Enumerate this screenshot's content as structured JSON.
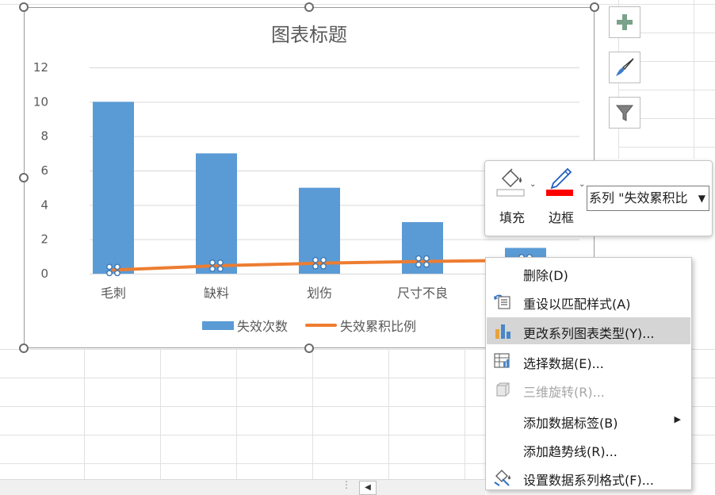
{
  "chart": {
    "title": "图表标题"
  },
  "chart_data": {
    "type": "bar",
    "categories": [
      "毛刺",
      "缺料",
      "划伤",
      "尺寸不良",
      ""
    ],
    "series": [
      {
        "name": "失效次数",
        "type": "bar",
        "values": [
          10,
          7,
          5,
          3,
          1.5
        ]
      },
      {
        "name": "失效累积比例",
        "type": "line",
        "values": [
          0.38,
          0.65,
          0.81,
          0.92,
          1.0
        ]
      }
    ],
    "yticks": [
      "0",
      "2",
      "4",
      "6",
      "8",
      "10",
      "12"
    ],
    "ylim": [
      0,
      12
    ],
    "grid": true,
    "legend": "bottom",
    "colors": {
      "bar": "#5b9bd5",
      "line": "#ed7d31"
    }
  },
  "side_buttons": [
    {
      "icon": "plus-icon"
    },
    {
      "icon": "paintbrush-icon"
    },
    {
      "icon": "filter-icon"
    }
  ],
  "mini_toolbar": {
    "fill_label": "填充",
    "border_label": "边框",
    "series_select": "系列 \"失效累积比"
  },
  "context_menu": {
    "items": [
      {
        "label": "删除(D)",
        "icon": ""
      },
      {
        "label": "重设以匹配样式(A)",
        "icon": "reset-style-icon"
      },
      {
        "label": "更改系列图表类型(Y)...",
        "icon": "change-chart-type-icon"
      },
      {
        "label": "选择数据(E)...",
        "icon": "select-data-icon"
      },
      {
        "label": "三维旋转(R)...",
        "icon": "3d-rotation-icon"
      },
      {
        "label": "添加数据标签(B)",
        "icon": ""
      },
      {
        "label": "添加趋势线(R)...",
        "icon": ""
      },
      {
        "label": "设置数据系列格式(F)...",
        "icon": "format-series-icon"
      }
    ]
  }
}
